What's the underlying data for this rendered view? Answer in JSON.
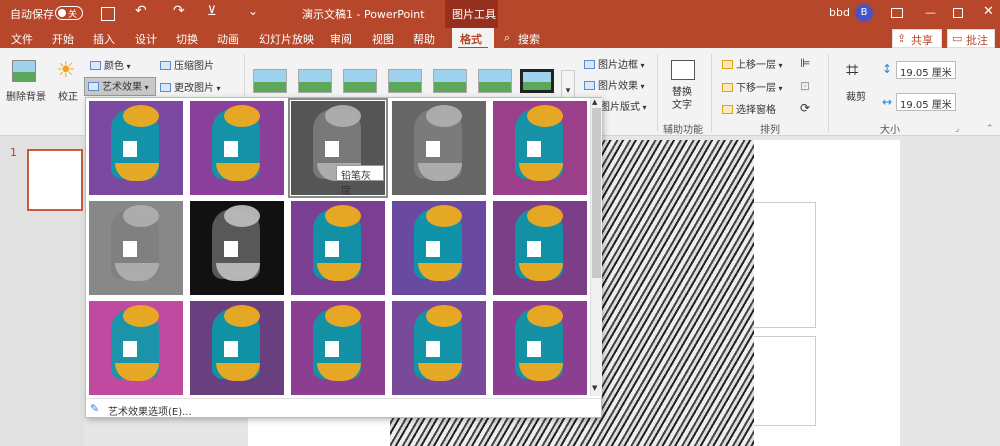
{
  "titlebar": {
    "autosave_label": "自动保存",
    "autosave_state": "关",
    "title": "演示文稿1  -  PowerPoint",
    "context_tab": "图片工具",
    "user_name": "bbd",
    "user_initial": "B"
  },
  "tabs": [
    "文件",
    "开始",
    "插入",
    "设计",
    "切换",
    "动画",
    "幻灯片放映",
    "审阅",
    "视图",
    "帮助",
    "格式"
  ],
  "search_label": "搜索",
  "share_label": "共享",
  "comment_label": "批注",
  "ribbon": {
    "remove_bg": "删除背景",
    "correct": "校正",
    "color": "颜色",
    "artistic": "艺术效果",
    "compress": "压缩图片",
    "change_pic": "更改图片",
    "border": "图片边框",
    "effects": "图片效果",
    "layout": "图片版式",
    "alt_text": "替换\n文字",
    "assist_group": "辅助功能",
    "bring_forward": "上移一层",
    "send_backward": "下移一层",
    "selection_pane": "选择窗格",
    "arrange_group": "排列",
    "crop": "裁剪",
    "height": "19.05 厘米",
    "width": "19.05 厘米",
    "size_group": "大小"
  },
  "dropdown": {
    "tooltip": "铅笔灰度",
    "options_label": "艺术效果选项(E)..."
  },
  "slide_number": "1",
  "colors": {
    "accent": "#b7472a"
  }
}
